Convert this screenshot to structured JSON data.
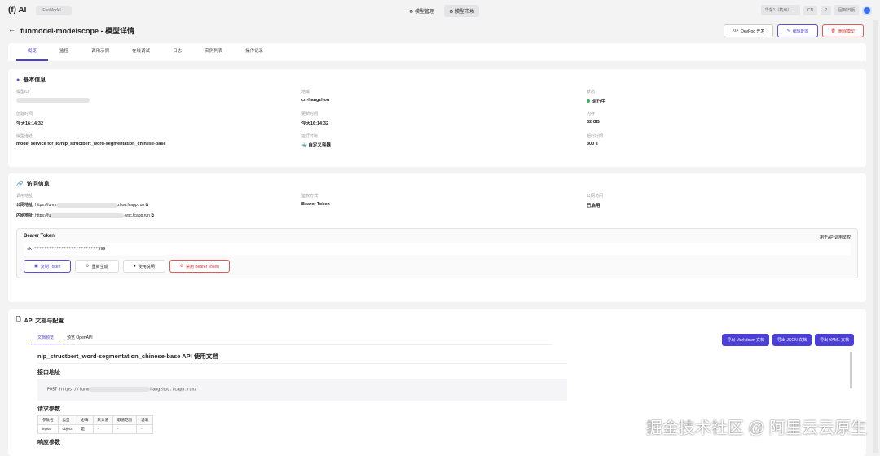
{
  "topbar": {
    "logo": "(f) AI",
    "workspace": "FunModel",
    "nav": [
      "模型管理",
      "模型市场"
    ],
    "region": "华东1（杭州）",
    "lang": "CN",
    "help": "?",
    "old": "回到旧版"
  },
  "header": {
    "back": "←",
    "title": "funmodel-modelscope - 模型详情",
    "devpod": "DevPod 开发",
    "edit": "编辑配置",
    "delete": "删除模型"
  },
  "tabs": [
    "概览",
    "监控",
    "调用示例",
    "在线调试",
    "日志",
    "实例列表",
    "操作记录"
  ],
  "basic": {
    "title": "基本信息",
    "fields": [
      {
        "label": "模型ID",
        "value": ""
      },
      {
        "label": "地域",
        "value": "cn-hangzhou"
      },
      {
        "label": "状态",
        "value": "运行中"
      },
      {
        "label": "创建时间",
        "value": "今天16:14:32"
      },
      {
        "label": "更新时间",
        "value": "今天16:14:32"
      },
      {
        "label": "内存",
        "value": "32 GB"
      },
      {
        "label": "模型描述",
        "value": "model service for iic/nlp_structbert_word-segmentation_chinese-base"
      },
      {
        "label": "运行环境",
        "value": "自定义容器"
      },
      {
        "label": "超时时间",
        "value": "300 s"
      }
    ]
  },
  "access": {
    "title": "访问信息",
    "call_label": "调用地址",
    "public_label": "公网地址:",
    "public_a": "https://funm",
    "public_b": "zhou.fcapp.run",
    "private_label": "内网地址:",
    "private_a": "https://fu",
    "private_b": "-vpc.fcapp.run",
    "auth_label": "鉴权方式",
    "auth": "Bearer Token",
    "pub_access_label": "公网访问",
    "pub_access": "已启用",
    "token_title": "Bearer Token",
    "token_hint": "用于API调用鉴权",
    "token": "sk-**************************999",
    "copy": "复制 Token",
    "regen": "重新生成",
    "usage": "使用说明",
    "disable": "禁用 Bearer Token"
  },
  "api": {
    "title": "API 文档与配置",
    "subtabs": [
      "文档预览",
      "预览 OpenAPI"
    ],
    "exports": [
      "导出 Markdown 文档",
      "导出 JSON 文档",
      "导出 YAML 文档"
    ],
    "doc_title": "nlp_structbert_word-segmentation_chinese-base API 使用文档",
    "endpoint_h": "接口地址",
    "endpoint_a": "POST https://funm",
    "endpoint_b": "hangzhou.fcapp.run/",
    "req_h": "请求参数",
    "cols": [
      "参数名",
      "类型",
      "必填",
      "默认值",
      "取值范围",
      "说明"
    ],
    "row": [
      "input",
      "object",
      "是",
      "-",
      "-",
      "-"
    ],
    "resp_h": "响应参数"
  },
  "watermark": "掘金技术社区 @ 阿里云云原生"
}
